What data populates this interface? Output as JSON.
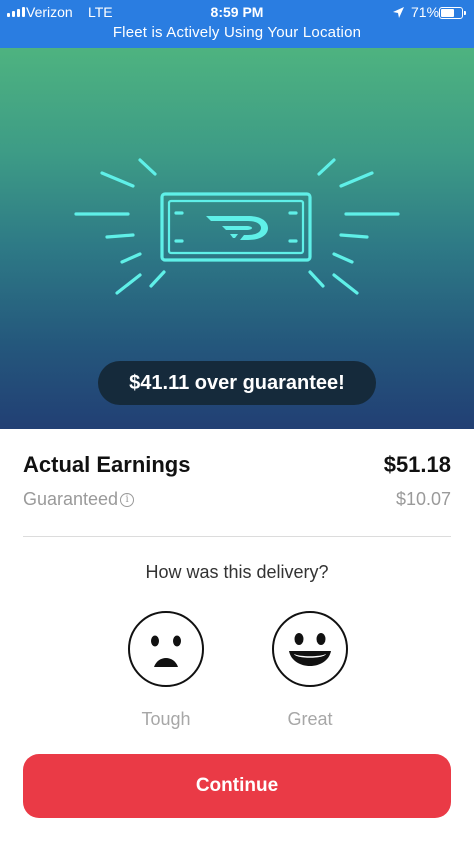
{
  "status_bar": {
    "carrier": "Verizon",
    "network": "LTE",
    "time": "8:59 PM",
    "battery": "71%",
    "battery_level": 0.71,
    "location_banner": "Fleet is Actively Using Your Location"
  },
  "hero": {
    "badge_text": "$41.11 over guarantee!",
    "illustration": "dasher-logo-cash-icon",
    "gradient_top": "#4eb380",
    "gradient_bottom": "#223f74",
    "line_color": "#5ff0e8"
  },
  "earnings": {
    "actual_label": "Actual Earnings",
    "actual_amount": "$51.18",
    "guaranteed_label": "Guaranteed",
    "guaranteed_amount": "$10.07"
  },
  "feedback": {
    "question": "How was this delivery?",
    "options": [
      {
        "label": "Tough",
        "icon": "sad-face-icon"
      },
      {
        "label": "Great",
        "icon": "happy-face-icon"
      }
    ]
  },
  "continue_label": "Continue",
  "accent_color": "#ea3a46"
}
